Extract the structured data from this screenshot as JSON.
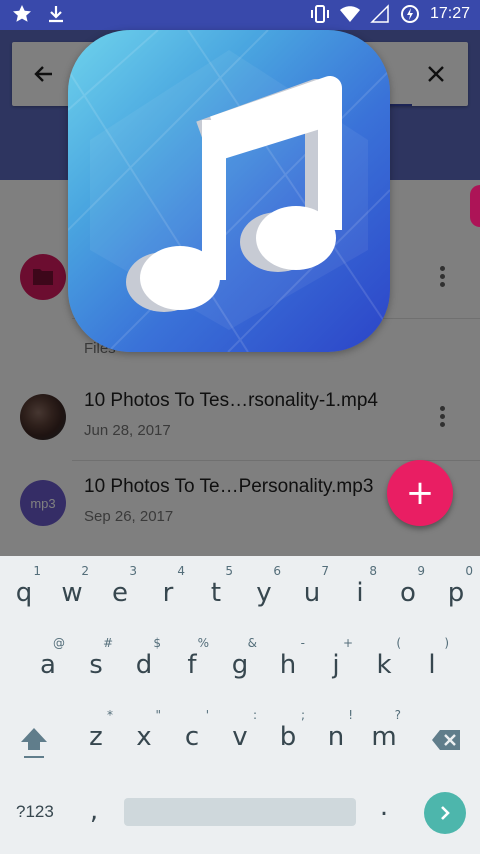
{
  "status_bar": {
    "left_icons": [
      "star-icon",
      "download-icon"
    ],
    "right_icons": [
      "vibrate-icon",
      "wifi-icon",
      "signal-icon",
      "data-saver-icon"
    ],
    "time": "17:27"
  },
  "search": {
    "value": "",
    "placeholder": "",
    "back_icon": "arrow-back-icon",
    "close_icon": "close-icon"
  },
  "list": {
    "section_label": "Files",
    "items": [
      {
        "title": "10 Photos To Tes…rsonality-1.mp4",
        "date": "Jun 28, 2017",
        "avatar": "thumbnail"
      },
      {
        "title": "10 Photos To Te…Personality.mp3",
        "date": "Sep 26, 2017",
        "avatar_text": "mp3"
      }
    ]
  },
  "fab": {
    "label": "+"
  },
  "keyboard": {
    "row1": [
      {
        "k": "q",
        "h": "1"
      },
      {
        "k": "w",
        "h": "2"
      },
      {
        "k": "e",
        "h": "3"
      },
      {
        "k": "r",
        "h": "4"
      },
      {
        "k": "t",
        "h": "5"
      },
      {
        "k": "y",
        "h": "6"
      },
      {
        "k": "u",
        "h": "7"
      },
      {
        "k": "i",
        "h": "8"
      },
      {
        "k": "o",
        "h": "9"
      },
      {
        "k": "p",
        "h": "0"
      }
    ],
    "row2": [
      {
        "k": "a",
        "h": "@"
      },
      {
        "k": "s",
        "h": "#"
      },
      {
        "k": "d",
        "h": "$"
      },
      {
        "k": "f",
        "h": "%"
      },
      {
        "k": "g",
        "h": "&"
      },
      {
        "k": "h",
        "h": "-"
      },
      {
        "k": "j",
        "h": "+"
      },
      {
        "k": "k",
        "h": "("
      },
      {
        "k": "l",
        "h": ")"
      }
    ],
    "row3": [
      {
        "k": "z",
        "h": "*"
      },
      {
        "k": "x",
        "h": "\""
      },
      {
        "k": "c",
        "h": "'"
      },
      {
        "k": "v",
        "h": ":"
      },
      {
        "k": "b",
        "h": ";"
      },
      {
        "k": "n",
        "h": "!"
      },
      {
        "k": "m",
        "h": "?"
      }
    ],
    "symbols_label": "?123",
    "comma": ",",
    "period": "."
  },
  "colors": {
    "status_bar": "#3949ab",
    "app_bar": "#5c6bc0",
    "fab": "#e91e63",
    "folder": "#d81b60",
    "mp3_avatar": "#6a5acd",
    "enter_key": "#4db6ac"
  }
}
